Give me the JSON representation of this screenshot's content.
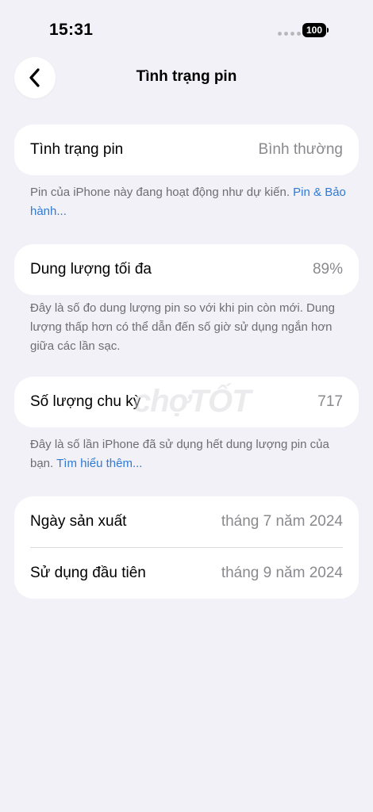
{
  "status_bar": {
    "time": "15:31",
    "battery_level": "100"
  },
  "nav": {
    "title": "Tình trạng pin",
    "back_icon": "chevron-left-icon"
  },
  "battery_health": {
    "label": "Tình trạng pin",
    "value": "Bình thường",
    "footnote_text": "Pin của iPhone này đang hoạt động như dự kiến.",
    "footnote_link": "Pin & Bảo hành..."
  },
  "max_capacity": {
    "label": "Dung lượng tối đa",
    "value": "89%",
    "footnote_text": "Đây là số đo dung lượng pin so với khi pin còn mới. Dung lượng thấp hơn có thể dẫn đến số giờ sử dụng ngắn hơn giữa các lần sạc."
  },
  "cycle_count": {
    "label": "Số lượng chu kỳ",
    "value": "717",
    "footnote_text": "Đây là số lần iPhone đã sử dụng hết dung lượng pin của bạn.",
    "footnote_link": "Tìm hiểu thêm..."
  },
  "dates": {
    "manufacture_label": "Ngày sản xuất",
    "manufacture_value": "tháng 7 năm 2024",
    "first_use_label": "Sử dụng đầu tiên",
    "first_use_value": "tháng 9 năm 2024"
  },
  "watermark": "chợTỐT",
  "colors": {
    "background": "#f2f1f7",
    "link": "#2f7ad4",
    "secondary_text": "#8a8a8e"
  }
}
